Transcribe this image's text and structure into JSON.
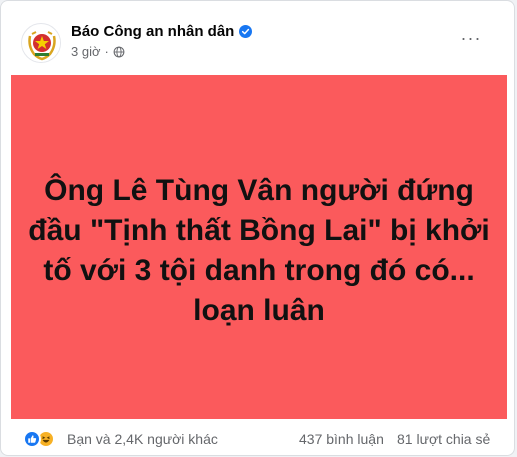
{
  "post": {
    "author": "Báo Công an nhân dân",
    "time": "3 giờ",
    "verified": true,
    "more_label": "···",
    "banner": {
      "headline": "Ông Lê Tùng Vân người đứng đầu \"Tịnh thất Bồng Lai\" bị khởi tố với 3 tội danh trong đó có... loạn luân",
      "background_color": "#fb5a5c"
    },
    "footer": {
      "reactions": [
        "like-icon",
        "haha-icon"
      ],
      "reaction_text": "Bạn và 2,4K người khác",
      "comments": "437 bình luận",
      "shares": "81 lượt chia sẻ"
    }
  },
  "colors": {
    "accent": "#1877f2",
    "secondary_text": "#65676b"
  }
}
